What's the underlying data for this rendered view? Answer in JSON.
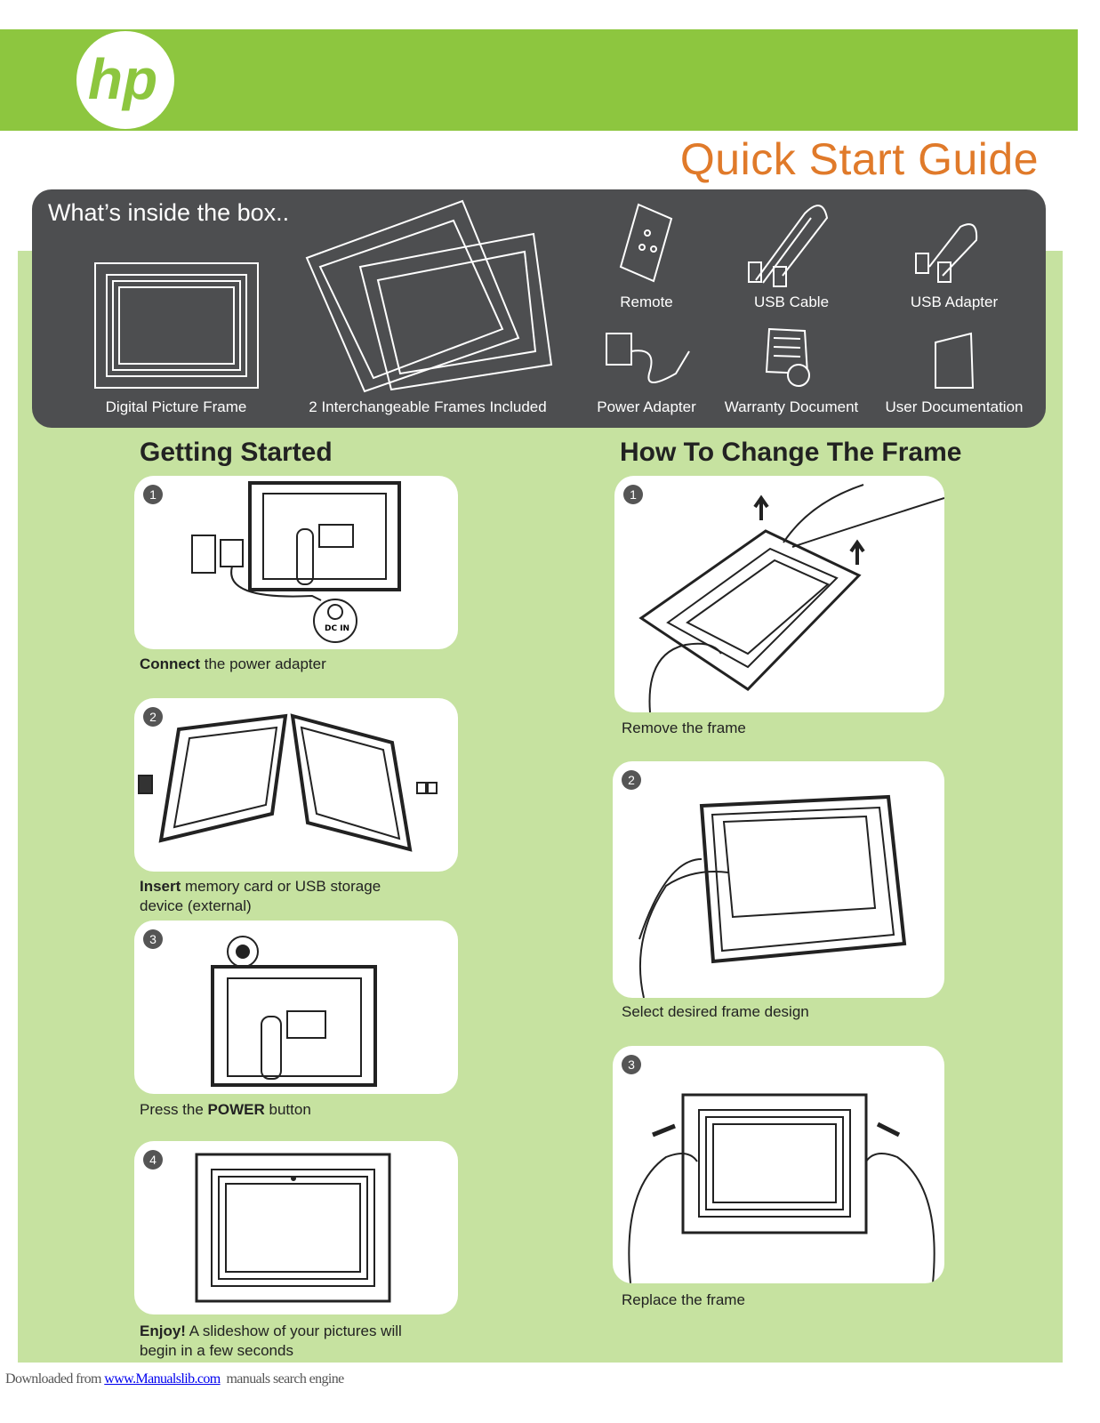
{
  "brand": {
    "logo_text": "hp",
    "band_color": "#8dc63f"
  },
  "title": "Quick Start Guide",
  "title_color": "#e07a2a",
  "box": {
    "heading": "What’s inside the box..",
    "items": [
      {
        "label": "Digital Picture Frame",
        "icon": "picture-frame-icon"
      },
      {
        "label": "2 Interchangeable Frames Included",
        "icon": "frames-icon"
      },
      {
        "label": "Remote",
        "icon": "remote-icon"
      },
      {
        "label": "USB Cable",
        "icon": "usb-cable-icon"
      },
      {
        "label": "USB Adapter",
        "icon": "usb-adapter-icon"
      },
      {
        "label": "Power Adapter",
        "icon": "power-adapter-icon"
      },
      {
        "label": "Warranty Document",
        "icon": "warranty-icon"
      },
      {
        "label": "User Documentation",
        "icon": "document-icon"
      }
    ]
  },
  "getting_started": {
    "heading": "Getting Started",
    "steps": [
      {
        "num": "1",
        "bold": "Connect",
        "text": " the power adapter",
        "text2": ""
      },
      {
        "num": "2",
        "bold": "Insert",
        "text": " memory card or USB storage",
        "text2": "device (external)"
      },
      {
        "num": "3",
        "pre": "Press the ",
        "bold": "POWER",
        "text": " button"
      },
      {
        "num": "4",
        "bold": "Enjoy!",
        "text": " A slideshow of your pictures will",
        "text2": "begin in a few seconds"
      }
    ],
    "dc_in_label": "DC IN"
  },
  "change_frame": {
    "heading": "How To Change The Frame",
    "steps": [
      {
        "num": "1",
        "text": "Remove the frame"
      },
      {
        "num": "2",
        "text": "Select desired frame design"
      },
      {
        "num": "3",
        "text": "Replace the frame"
      }
    ]
  },
  "footer": {
    "prefix": "Downloaded from ",
    "link": "www.Manualslib.com",
    "suffix": "  manuals search engine"
  }
}
